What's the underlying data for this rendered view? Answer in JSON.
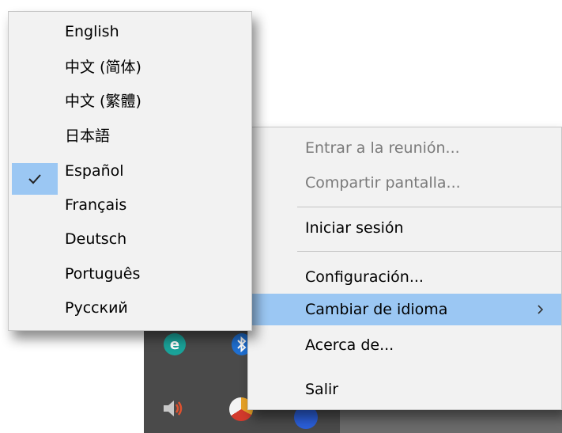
{
  "language_menu": {
    "items": [
      {
        "label": "English",
        "checked": false
      },
      {
        "label": "中文 (简体)",
        "checked": false
      },
      {
        "label": "中文 (繁體)",
        "checked": false
      },
      {
        "label": "日本語",
        "checked": false
      },
      {
        "label": "Español",
        "checked": true
      },
      {
        "label": "Français",
        "checked": false
      },
      {
        "label": "Deutsch",
        "checked": false
      },
      {
        "label": "Português",
        "checked": false
      },
      {
        "label": "Русский",
        "checked": false
      }
    ]
  },
  "context_menu": {
    "join_meeting": "Entrar a la reunión...",
    "share_screen": "Compartir pantalla...",
    "sign_in": "Iniciar sesión",
    "settings": "Configuración...",
    "change_language": "Cambiar de idioma",
    "about": "Acerca de...",
    "exit": "Salir"
  },
  "tray": {
    "eset_letter": "e",
    "icons": [
      "eset-icon",
      "bluetooth-icon",
      "speaker-icon",
      "browser-icon",
      "blue-app-icon"
    ]
  },
  "colors": {
    "highlight": "#9bc7f3",
    "menu_background": "#f2f2f2",
    "disabled_text": "#7a7a7a",
    "taskbar": "#4a4a4a"
  }
}
